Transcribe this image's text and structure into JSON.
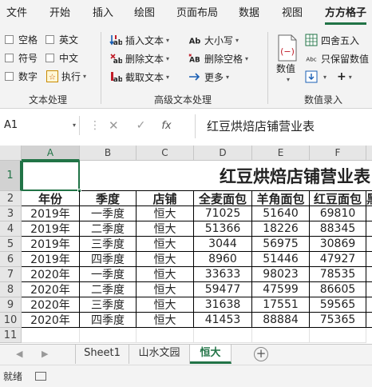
{
  "menu": {
    "tabs": [
      "文件",
      "开始",
      "插入",
      "绘图",
      "页面布局",
      "数据",
      "视图",
      "方方格子"
    ],
    "active_tab": "方方格子"
  },
  "ribbon": {
    "text_processing": {
      "label": "文本处理",
      "options": [
        "空格",
        "英文",
        "符号",
        "中文",
        "数字"
      ],
      "execute": "执行"
    },
    "advanced_text": {
      "label": "高级文本处理",
      "insert_text": "插入文本",
      "delete_text": "删除文本",
      "extract_text": "截取文本",
      "case": "大小写",
      "delete_spaces": "删除空格",
      "more": "更多"
    },
    "numeric_entry": {
      "label": "数值录入",
      "value": "数值",
      "round": "四舍五入",
      "keep_numbers": "只保留数值"
    }
  },
  "formula_bar": {
    "cell_ref": "A1",
    "fx": "fx",
    "content": "红豆烘焙店铺营业表"
  },
  "sheet": {
    "columns": [
      "A",
      "B",
      "C",
      "D",
      "E",
      "F"
    ],
    "rows": [
      "1",
      "2",
      "3",
      "4",
      "5",
      "6",
      "7",
      "8",
      "9",
      "10",
      "11"
    ],
    "title": "红豆烘焙店铺营业表",
    "headers": [
      "年份",
      "季度",
      "店铺",
      "全麦面包",
      "羊角面包",
      "红豆面包"
    ],
    "data": [
      [
        "2019年",
        "一季度",
        "恒大",
        "71025",
        "51640",
        "69810"
      ],
      [
        "2019年",
        "二季度",
        "恒大",
        "51366",
        "18226",
        "88345"
      ],
      [
        "2019年",
        "三季度",
        "恒大",
        "3044",
        "56975",
        "30869"
      ],
      [
        "2019年",
        "四季度",
        "恒大",
        "8960",
        "51446",
        "47927"
      ],
      [
        "2020年",
        "一季度",
        "恒大",
        "33633",
        "98023",
        "78535"
      ],
      [
        "2020年",
        "二季度",
        "恒大",
        "59477",
        "47599",
        "86605"
      ],
      [
        "2020年",
        "三季度",
        "恒大",
        "31638",
        "17551",
        "59565"
      ],
      [
        "2020年",
        "四季度",
        "恒大",
        "41453",
        "88884",
        "75365"
      ]
    ]
  },
  "sheet_tabs": [
    "Sheet1",
    "山水文园",
    "恒大"
  ],
  "active_sheet": "恒大",
  "status": {
    "text": "就绪"
  },
  "colors": {
    "accent": "#217346",
    "ribbon_bg": "#f3f3f3"
  }
}
